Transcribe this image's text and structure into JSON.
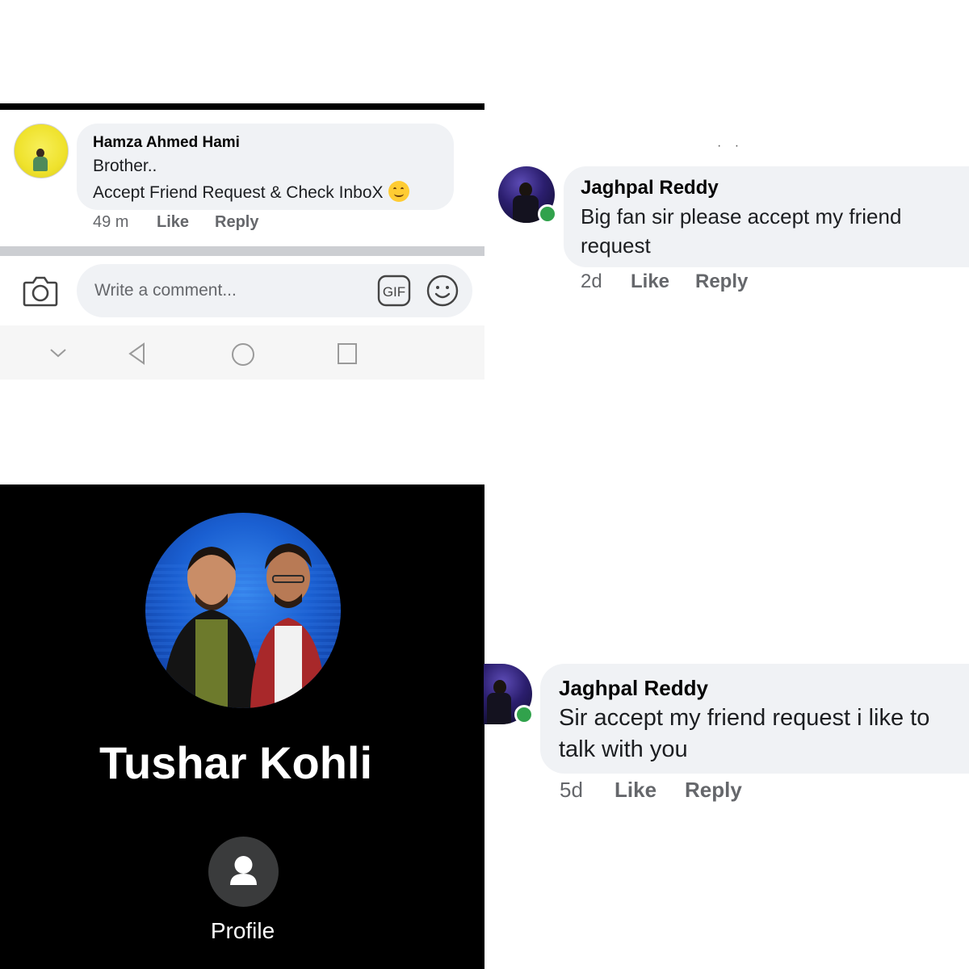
{
  "panel1": {
    "comment": {
      "author": "Hamza Ahmed Hami",
      "line1": "Brother..",
      "line2": "Accept Friend Request & Check InboX",
      "emoji_icon": "smiling-face-icon",
      "time": "49 m",
      "like_label": "Like",
      "reply_label": "Reply"
    },
    "composer": {
      "placeholder": "Write a comment...",
      "camera_icon": "camera-icon",
      "gif_label": "GIF",
      "emoji_icon": "smiley-icon"
    },
    "navbar_icons": [
      "chevron-down-icon",
      "back-triangle-icon",
      "home-circle-icon",
      "recents-square-icon"
    ]
  },
  "panel2": {
    "comment": {
      "author": "Jaghpal Reddy",
      "text": "Big fan sir please accept my friend request",
      "time": "2d",
      "like_label": "Like",
      "reply_label": "Reply",
      "online": true
    }
  },
  "panel3": {
    "profile_name": "Tushar Kohli",
    "button_label": "Profile",
    "button_icon": "person-icon"
  },
  "panel4": {
    "comment": {
      "author": "Jaghpal Reddy",
      "text": "Sir accept my friend request i like to talk with you",
      "time": "5d",
      "like_label": "Like",
      "reply_label": "Reply",
      "online": true
    }
  },
  "colors": {
    "bubble": "#f0f2f5",
    "meta_text": "#65676b",
    "online_green": "#31a24c",
    "profile_bg": "#000000"
  }
}
